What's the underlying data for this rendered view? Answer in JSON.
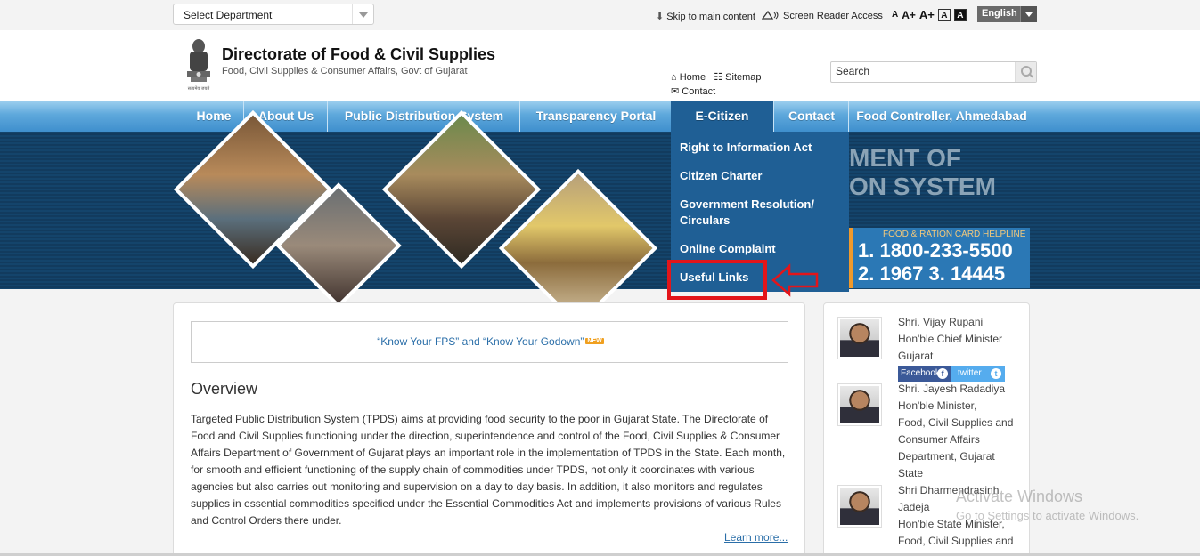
{
  "topbar": {
    "department_select": "Select Department",
    "skip_link": "Skip to main content",
    "screen_reader": "Screen Reader Access",
    "font_sizes": [
      "A",
      "A+",
      "A+",
      "A",
      "A"
    ],
    "language": "English"
  },
  "header": {
    "title": "Directorate of Food & Civil Supplies",
    "subtitle": "Food, Civil Supplies & Consumer Affairs, Govt of Gujarat",
    "emblem_caption": "सत्यमेव जयते",
    "links": {
      "home": "Home",
      "sitemap": "Sitemap",
      "contact": "Contact"
    },
    "search_placeholder": "Search"
  },
  "nav": {
    "items": [
      "Home",
      "About Us",
      "Public Distribution System",
      "Transparency Portal",
      "E-Citizen",
      "Contact",
      "Food Controller, Ahmedabad"
    ],
    "active": "E-Citizen"
  },
  "dropdown": {
    "items": [
      "Right to Information Act",
      "Citizen Charter",
      "Government Resolution/ Circulars",
      "Online Complaint",
      "Useful Links"
    ],
    "highlighted": "Useful Links"
  },
  "banner": {
    "line1": "MENT OF",
    "line2": "ON SYSTEM",
    "helpline_title": "FOOD & RATION CARD HELPLINE",
    "helpline_line1": "1. 1800-233-5500",
    "helpline_line2": "2. 1967  3. 14445"
  },
  "main": {
    "fps_link": "“Know Your FPS” and “Know Your Godown”",
    "new_badge": "NEW",
    "overview_title": "Overview",
    "overview_text": "Targeted Public Distribution System (TPDS) aims at providing food security to the poor in Gujarat State. The Directorate of Food and Civil Supplies functioning under the direction, superintendence and control of the Food, Civil Supplies & Consumer Affairs Department of Government of Gujarat plays an important role in the implementation of TPDS in the State. Each month, for smooth and efficient functioning of the supply chain of commodities under TPDS, not only it coordinates with various agencies but also carries out monitoring and supervision on a day to day basis. In addition, it also monitors and regulates supplies in essential commodities specified under the Essential Commodities Act and implements provisions of various Rules and Control Orders there under.",
    "learn_more": "Learn more..."
  },
  "panel": {
    "person1": "Shri. Vijay Rupani\nHon'ble Chief Minister\nGujarat",
    "facebook": "Facebook",
    "twitter": "twitter",
    "person2": "Shri. Jayesh Radadiya\nHon'ble Minister,\nFood, Civil Supplies and\nConsumer Affairs\nDepartment, Gujarat\nState",
    "person3": "Shri Dharmendrasinh\nJadeja\nHon'ble State Minister,\nFood, Civil Supplies and"
  },
  "watermark": {
    "line1": "Activate Windows",
    "line2": "Go to Settings to activate Windows."
  },
  "colors": {
    "nav_gradient_top": "#9fd0ef",
    "nav_active": "#1f5f95",
    "banner_bg": "#123e63",
    "highlight": "#e3151a",
    "link": "#2a6ea8"
  }
}
